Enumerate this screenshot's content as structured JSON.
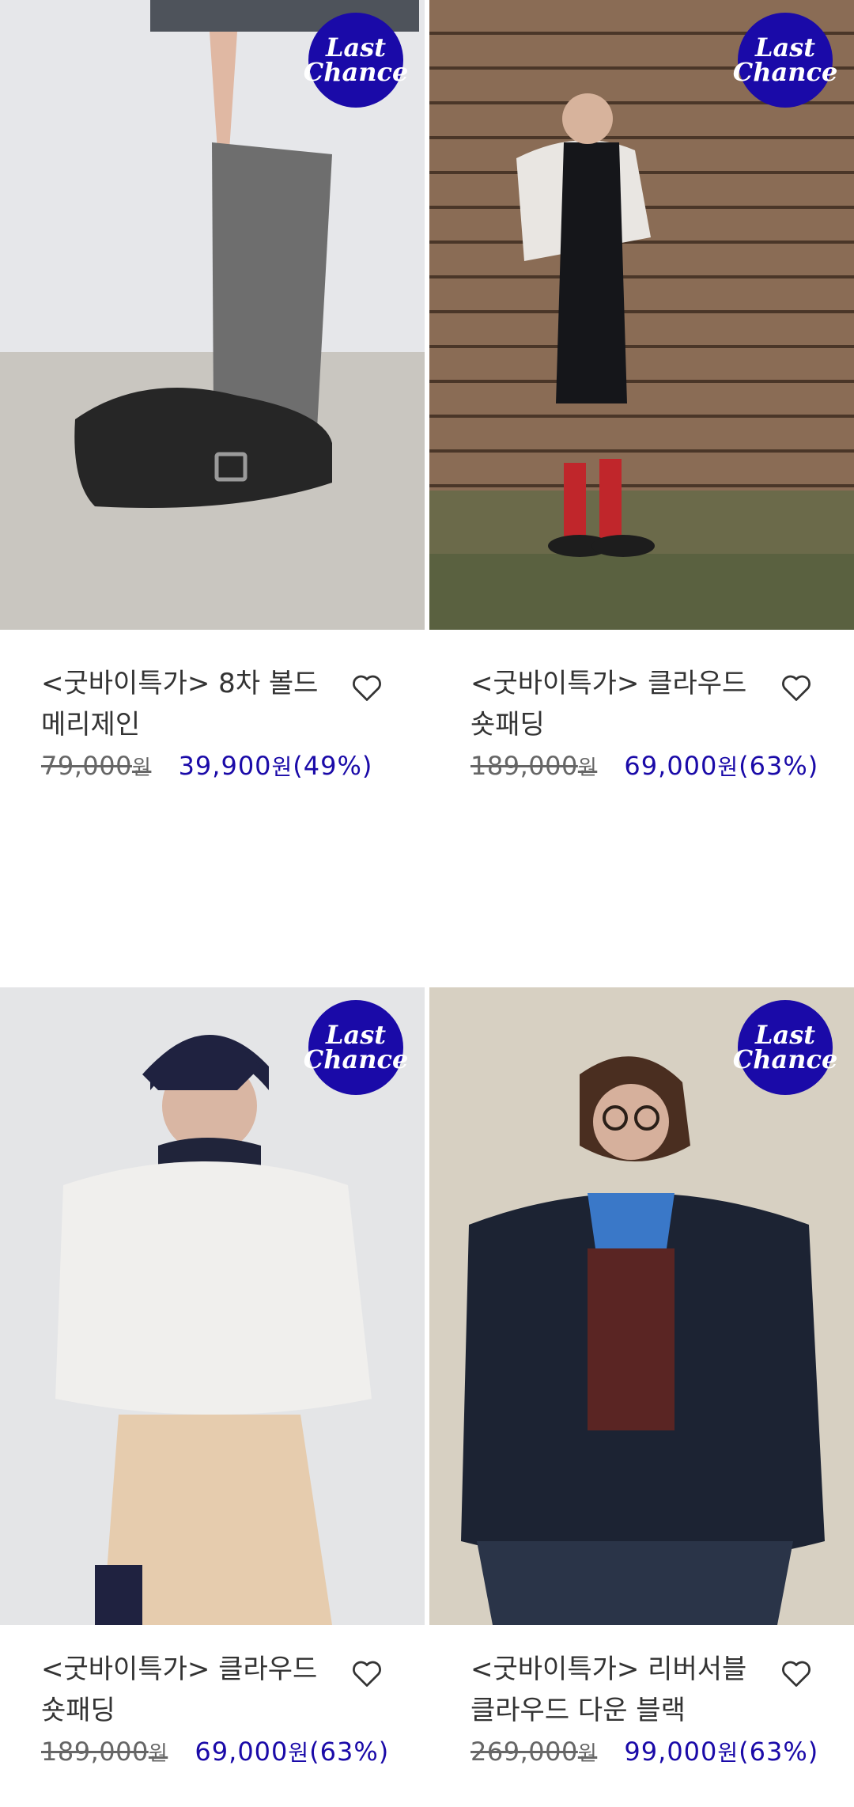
{
  "colors": {
    "accent": "#1a0aa8",
    "badge_text": "#ffffff",
    "original_price": "#666666",
    "title": "#333333"
  },
  "products": [
    {
      "badge": [
        "Last",
        "Chance"
      ],
      "name": "<굿바이특가> 8차 볼드 메리제인",
      "original_price": "79,000",
      "sale_price": "39,900",
      "currency": "원",
      "discount": "(49%)",
      "wishlist_icon": "heart-outline-icon"
    },
    {
      "badge": [
        "Last",
        "Chance"
      ],
      "name": "<굿바이특가> 클라우드 숏패딩",
      "original_price": "189,000",
      "sale_price": "69,000",
      "currency": "원",
      "discount": "(63%)",
      "wishlist_icon": "heart-outline-icon"
    },
    {
      "badge": [
        "Last",
        "Chance"
      ],
      "name": "<굿바이특가> 클라우드 숏패딩",
      "original_price": "189,000",
      "sale_price": "69,000",
      "currency": "원",
      "discount": "(63%)",
      "wishlist_icon": "heart-outline-icon"
    },
    {
      "badge": [
        "Last",
        "Chance"
      ],
      "name": "<굿바이특가> 리버서블 클라우드 다운 블랙",
      "original_price": "269,000",
      "sale_price": "99,000",
      "currency": "원",
      "discount": "(63%)",
      "wishlist_icon": "heart-outline-icon"
    }
  ]
}
